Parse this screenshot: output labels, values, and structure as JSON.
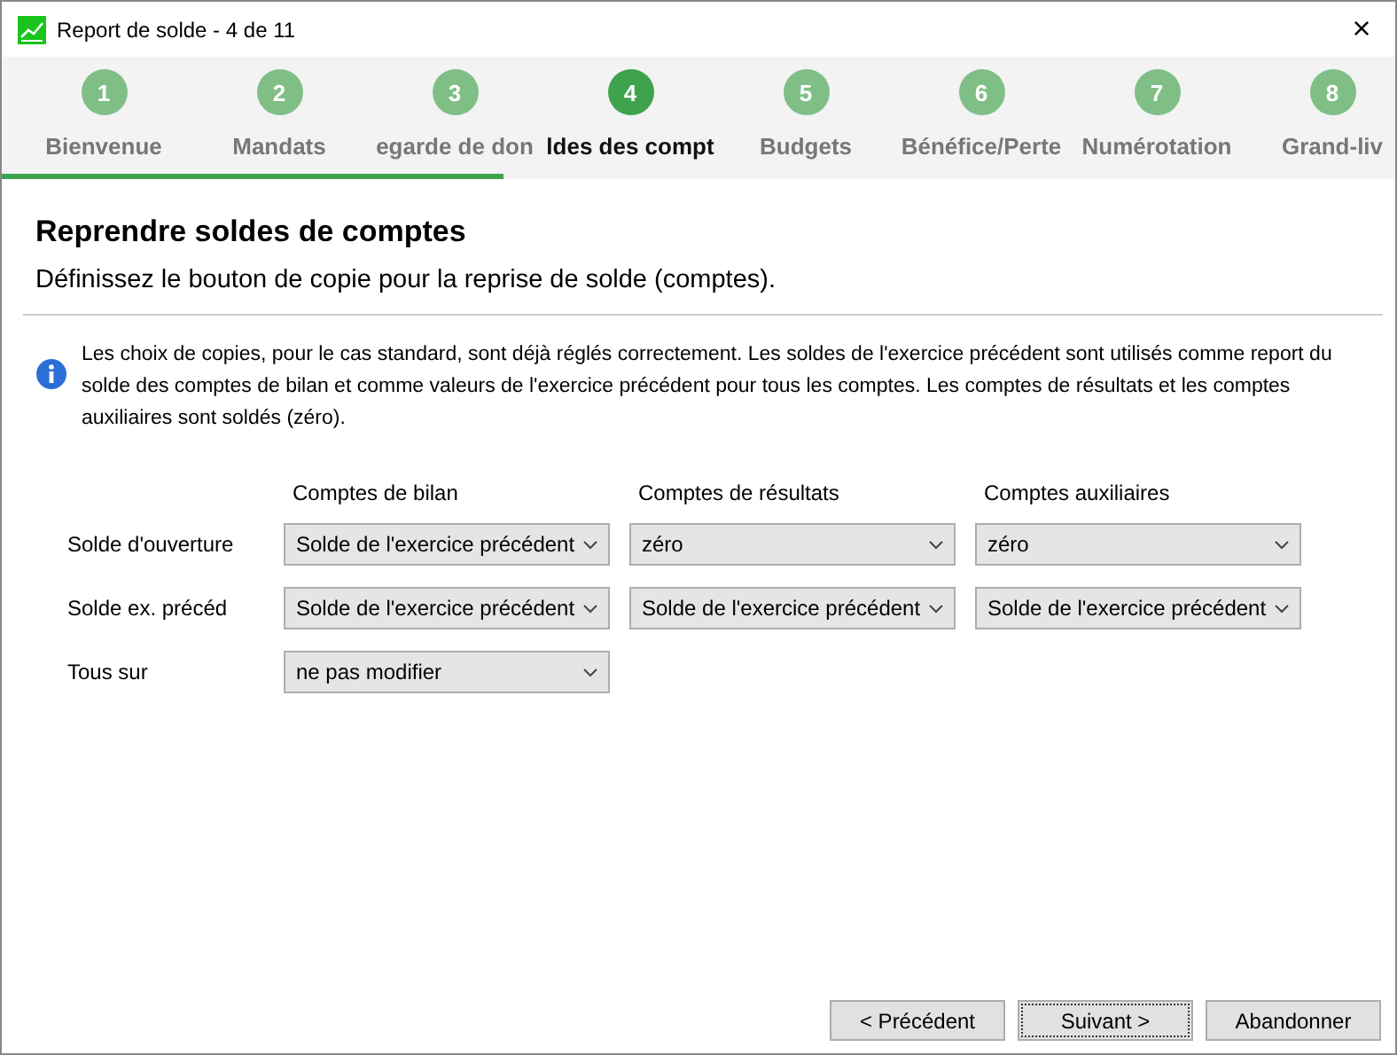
{
  "window": {
    "title": "Report de solde - 4 de 11",
    "close": "×"
  },
  "steps": [
    {
      "number": "1",
      "label": "Bienvenue",
      "selected": false
    },
    {
      "number": "2",
      "label": "Mandats",
      "selected": false
    },
    {
      "number": "3",
      "label": "egarde de don",
      "selected": false
    },
    {
      "number": "4",
      "label": "ldes des compt",
      "selected": true
    },
    {
      "number": "5",
      "label": "Budgets",
      "selected": false
    },
    {
      "number": "6",
      "label": "Bénéfice/Perte",
      "selected": false
    },
    {
      "number": "7",
      "label": "Numérotation",
      "selected": false
    },
    {
      "number": "8",
      "label": "Grand-liv",
      "selected": false
    }
  ],
  "progress": {
    "level": 0.36
  },
  "heading": "Reprendre soldes de comptes",
  "subtitle": "Définissez le bouton de copie pour la reprise de solde (comptes).",
  "info": "Les choix de copies, pour le cas standard, sont déjà réglés correctement. Les soldes de l'exercice précédent sont utilisés comme report du solde des comptes de bilan et comme valeurs de l'exercice précédent pour tous les comptes. Les comptes de résultats et les comptes auxiliaires sont soldés (zéro).",
  "table": {
    "columns": [
      "Comptes de bilan",
      "Comptes de résultats",
      "Comptes auxiliaires"
    ],
    "rows": [
      {
        "label": "Solde d'ouverture",
        "values": [
          "Solde de l'exercice précédent",
          "zéro",
          "zéro"
        ]
      },
      {
        "label": "Solde ex. précéd",
        "values": [
          "Solde de l'exercice précédent",
          "Solde de l'exercice précédent",
          "Solde de l'exercice précédent"
        ]
      },
      {
        "label": "Tous sur",
        "values": [
          "ne pas modifier"
        ]
      }
    ]
  },
  "buttons": [
    {
      "label": "< Précédent",
      "focused": false
    },
    {
      "label": "Suivant >",
      "focused": true
    },
    {
      "label": "Abandonner",
      "focused": false
    }
  ]
}
